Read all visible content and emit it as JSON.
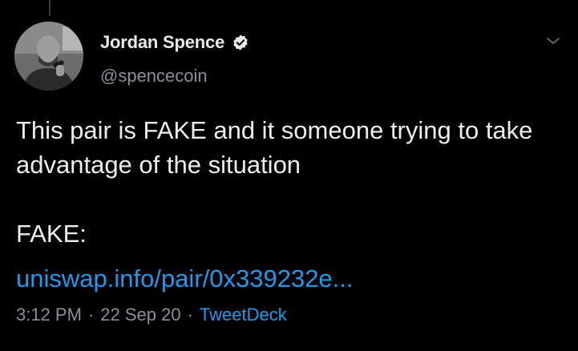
{
  "tweet": {
    "author": {
      "display_name": "Jordan Spence",
      "handle": "@spencecoin",
      "verified": true,
      "avatar_icon": "profile-photo"
    },
    "text": "This pair is FAKE and it someone trying to take advantage of the situation\n\nFAKE:",
    "link_text": "uniswap.info/pair/0x339232e...",
    "time": "3:12 PM",
    "date": "22 Sep 20",
    "separator": "·",
    "source": "TweetDeck",
    "menu_icon": "chevron-down-icon"
  },
  "colors": {
    "background": "#000000",
    "link": "#1d9bf0",
    "secondary_text": "#8b8f94",
    "primary_text": "#e7e9ea"
  }
}
